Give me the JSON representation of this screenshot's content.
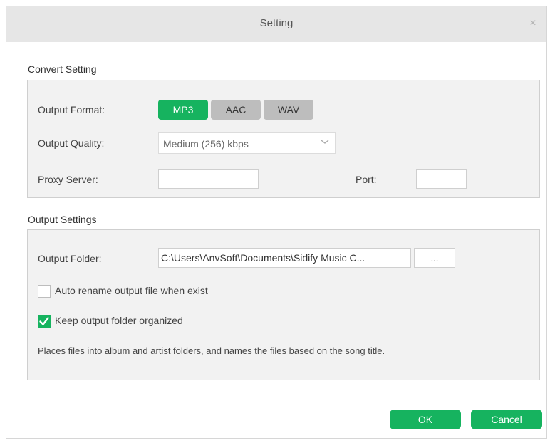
{
  "window": {
    "title": "Setting",
    "close_glyph": "×"
  },
  "convert": {
    "section_title": "Convert Setting",
    "output_format_label": "Output Format:",
    "formats": [
      {
        "label": "MP3",
        "selected": true
      },
      {
        "label": "AAC",
        "selected": false
      },
      {
        "label": "WAV",
        "selected": false
      }
    ],
    "output_quality_label": "Output Quality:",
    "output_quality_value": "Medium (256) kbps",
    "proxy_label": "Proxy Server:",
    "proxy_value": "",
    "port_label": "Port:",
    "port_value": ""
  },
  "output": {
    "section_title": "Output Settings",
    "folder_label": "Output Folder:",
    "folder_value": "C:\\Users\\AnvSoft\\Documents\\Sidify Music C...",
    "browse_label": "...",
    "auto_rename_label": "Auto rename output file when exist",
    "auto_rename_checked": false,
    "keep_organized_label": "Keep output folder organized",
    "keep_organized_checked": true,
    "description": "Places files into album and artist folders, and names the files based on the song title."
  },
  "footer": {
    "ok_label": "OK",
    "cancel_label": "Cancel"
  },
  "colors": {
    "accent": "#16b35f",
    "inactive": "#bdbdbd",
    "titlebar": "#e6e6e6",
    "panel": "#f2f2f2"
  },
  "icons": {
    "close": "close-icon",
    "dropdown": "chevron-down-icon",
    "check": "checkmark-icon"
  }
}
